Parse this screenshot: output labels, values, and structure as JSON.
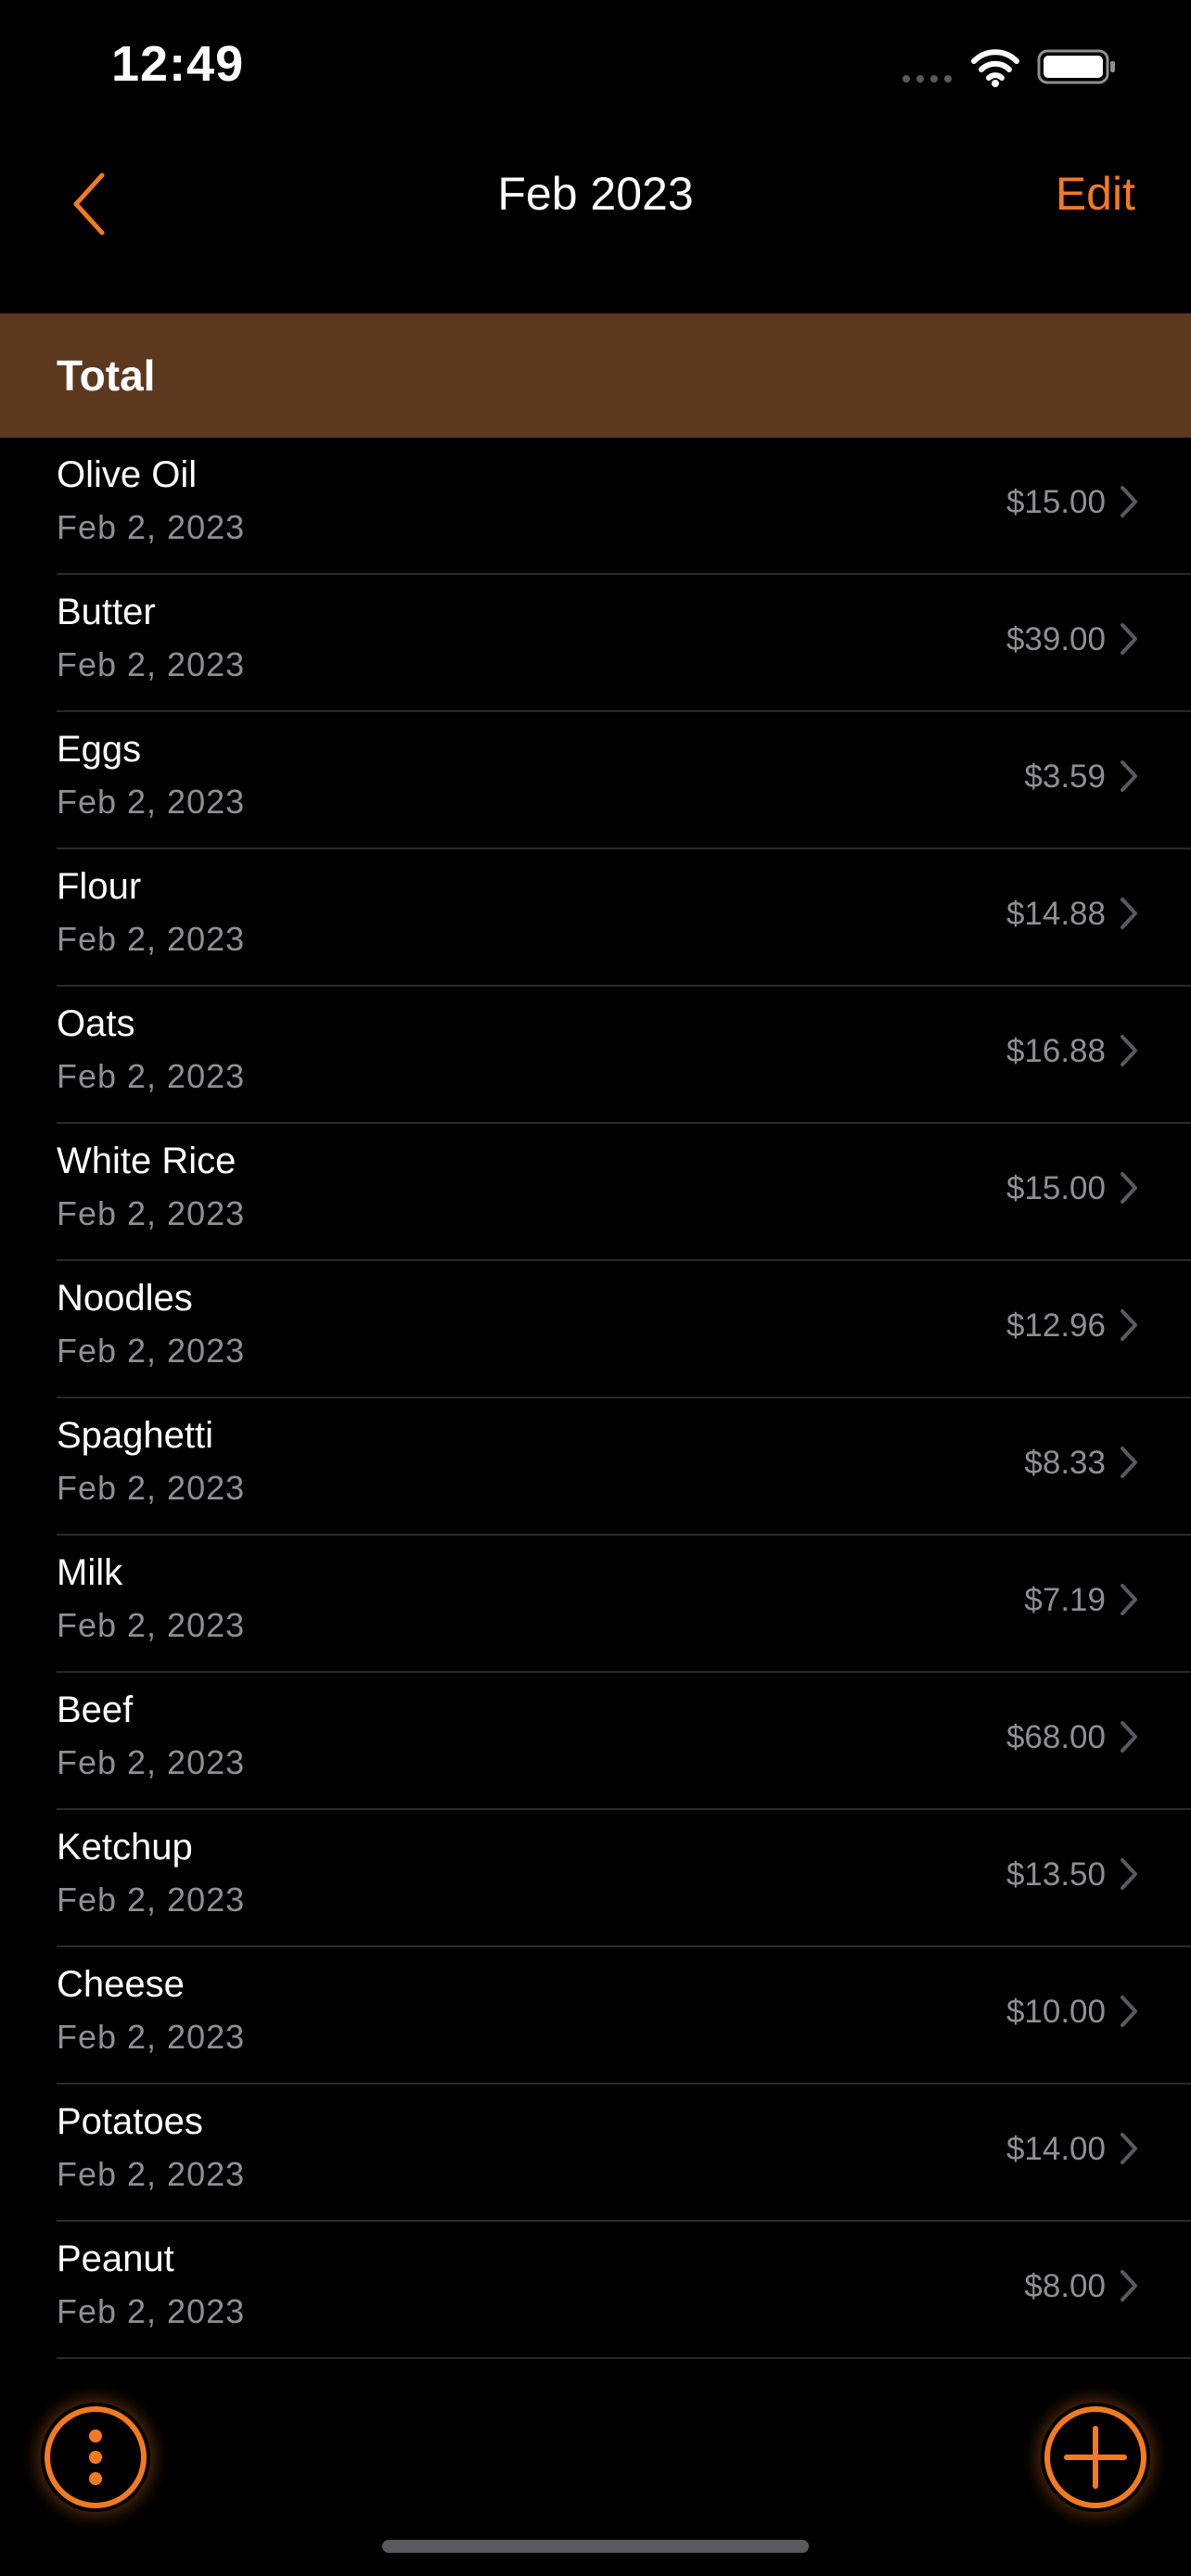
{
  "status_bar": {
    "time": "12:49"
  },
  "nav": {
    "title": "Feb 2023",
    "edit_label": "Edit",
    "accent_color": "#f47a1f"
  },
  "total_header": {
    "label": "Total",
    "background_color": "#5c391e"
  },
  "items": [
    {
      "name": "Olive Oil",
      "date": "Feb 2, 2023",
      "price": "$15.00"
    },
    {
      "name": "Butter",
      "date": "Feb 2, 2023",
      "price": "$39.00"
    },
    {
      "name": "Eggs",
      "date": "Feb 2, 2023",
      "price": "$3.59"
    },
    {
      "name": "Flour",
      "date": "Feb 2, 2023",
      "price": "$14.88"
    },
    {
      "name": "Oats",
      "date": "Feb 2, 2023",
      "price": "$16.88"
    },
    {
      "name": "White Rice",
      "date": "Feb 2, 2023",
      "price": "$15.00"
    },
    {
      "name": "Noodles",
      "date": "Feb 2, 2023",
      "price": "$12.96"
    },
    {
      "name": "Spaghetti",
      "date": "Feb 2, 2023",
      "price": "$8.33"
    },
    {
      "name": "Milk",
      "date": "Feb 2, 2023",
      "price": "$7.19"
    },
    {
      "name": "Beef",
      "date": "Feb 2, 2023",
      "price": "$68.00"
    },
    {
      "name": "Ketchup",
      "date": "Feb 2, 2023",
      "price": "$13.50"
    },
    {
      "name": "Cheese",
      "date": "Feb 2, 2023",
      "price": "$10.00"
    },
    {
      "name": "Potatoes",
      "date": "Feb 2, 2023",
      "price": "$14.00"
    },
    {
      "name": "Peanut",
      "date": "Feb 2, 2023",
      "price": "$8.00"
    }
  ],
  "icons": {
    "back": "chevron-left-icon",
    "row_disclosure": "chevron-right-icon",
    "menu_fab": "more-vertical-icon",
    "add_fab": "plus-icon"
  }
}
